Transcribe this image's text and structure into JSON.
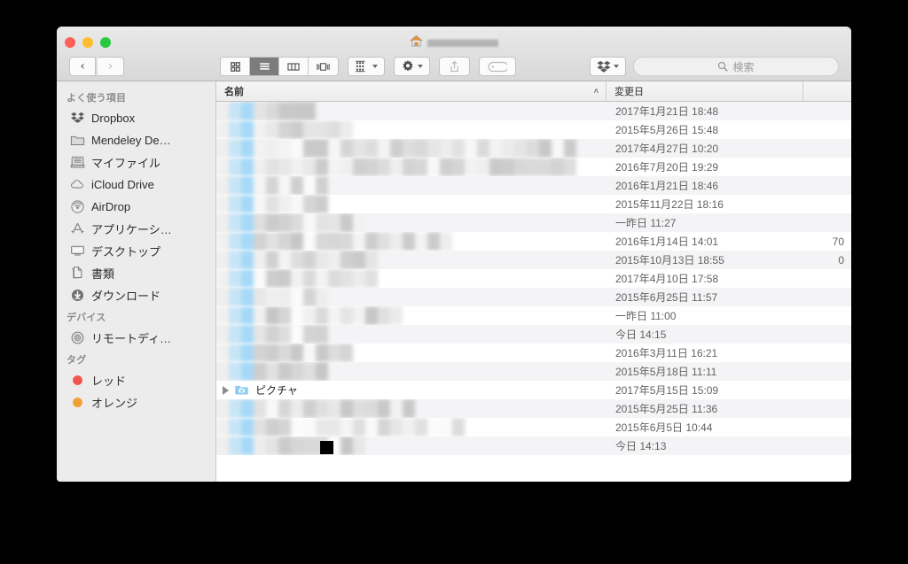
{
  "window": {
    "title_redacted": true,
    "traffic_lights": [
      {
        "name": "close",
        "color": "#ff5f56"
      },
      {
        "name": "minimize",
        "color": "#ffbd2e"
      },
      {
        "name": "zoom",
        "color": "#27c93f"
      }
    ],
    "home_icon": "home-icon"
  },
  "toolbar": {
    "back_label": "‹",
    "forward_label": "›",
    "view_modes": [
      {
        "name": "icon-view",
        "icon": "grid-icon",
        "active": false
      },
      {
        "name": "list-view",
        "icon": "list-icon",
        "active": true
      },
      {
        "name": "column-view",
        "icon": "columns-icon",
        "active": false
      },
      {
        "name": "cover-flow",
        "icon": "coverflow-icon",
        "active": false
      }
    ],
    "arrange_icon": "arrange-icon",
    "action_icon": "gear-icon",
    "share_icon": "share-icon",
    "tag_icon": "tag-icon",
    "dropbox_icon": "dropbox-icon"
  },
  "search": {
    "placeholder": "検索",
    "value": "",
    "icon": "search-icon"
  },
  "sidebar": {
    "sections": [
      {
        "header": "よく使う項目",
        "items": [
          {
            "label": "Dropbox",
            "icon": "dropbox-icon"
          },
          {
            "label": "Mendeley De…",
            "icon": "folder-icon"
          },
          {
            "label": "マイファイル",
            "icon": "myfiles-icon"
          },
          {
            "label": "iCloud Drive",
            "icon": "cloud-icon"
          },
          {
            "label": "AirDrop",
            "icon": "airdrop-icon"
          },
          {
            "label": "アプリケーシ…",
            "icon": "applications-icon"
          },
          {
            "label": "デスクトップ",
            "icon": "desktop-icon"
          },
          {
            "label": "書類",
            "icon": "documents-icon"
          },
          {
            "label": "ダウンロード",
            "icon": "downloads-icon"
          }
        ]
      },
      {
        "header": "デバイス",
        "items": [
          {
            "label": "リモートディ…",
            "icon": "disc-icon"
          }
        ]
      },
      {
        "header": "タグ",
        "items": [
          {
            "label": "レッド",
            "icon": "tag-dot-icon",
            "color": "#f0544a"
          },
          {
            "label": "オレンジ",
            "icon": "tag-dot-icon",
            "color": "#f0a030"
          }
        ]
      }
    ]
  },
  "filelist": {
    "columns": [
      {
        "key": "name",
        "label": "名前",
        "sorted": true,
        "sort_caret": "˄"
      },
      {
        "key": "date",
        "label": "変更日",
        "sorted": false
      },
      {
        "key": "size",
        "label": ""
      }
    ],
    "rows": [
      {
        "name_redacted": true,
        "name": "",
        "date": "2017年1月21日 18:48",
        "size": ""
      },
      {
        "name_redacted": true,
        "name": "",
        "date": "2015年5月26日 15:48",
        "size": ""
      },
      {
        "name_redacted": true,
        "name": "",
        "date": "2017年4月27日 10:20",
        "size": ""
      },
      {
        "name_redacted": true,
        "name": "",
        "date": "2016年7月20日 19:29",
        "size": ""
      },
      {
        "name_redacted": true,
        "name": "",
        "date": "2016年1月21日 18:46",
        "size": ""
      },
      {
        "name_redacted": true,
        "name": "",
        "date": "2015年11月22日 18:16",
        "size": ""
      },
      {
        "name_redacted": true,
        "name": "",
        "date": "一昨日 11:27",
        "size": ""
      },
      {
        "name_redacted": true,
        "name": "",
        "date": "2016年1月14日 14:01",
        "size": "70"
      },
      {
        "name_redacted": true,
        "name": "",
        "date": "2015年10月13日 18:55",
        "size": "0"
      },
      {
        "name_redacted": true,
        "name": "",
        "date": "2017年4月10日 17:58",
        "size": ""
      },
      {
        "name_redacted": true,
        "name": "",
        "date": "2015年6月25日 11:57",
        "size": ""
      },
      {
        "name_redacted": true,
        "name": "",
        "date": "一昨日 11:00",
        "size": ""
      },
      {
        "name_redacted": true,
        "name": "",
        "date": "今日 14:15",
        "size": ""
      },
      {
        "name_redacted": true,
        "name": "",
        "date": "2016年3月11日 16:21",
        "size": ""
      },
      {
        "name_redacted": true,
        "name": "",
        "date": "2015年5月18日 11:11",
        "size": ""
      },
      {
        "name_redacted": false,
        "name": "ピクチャ",
        "date": "2017年5月15日 15:09",
        "size": "",
        "has_twisty": true,
        "icon": "pictures-folder-icon"
      },
      {
        "name_redacted": true,
        "name": "",
        "date": "2015年5月25日 11:36",
        "size": ""
      },
      {
        "name_redacted": true,
        "name": "",
        "date": "2015年6月5日 10:44",
        "size": ""
      },
      {
        "name_redacted": true,
        "name": "",
        "date": "今日 14:13",
        "size": ""
      }
    ]
  }
}
